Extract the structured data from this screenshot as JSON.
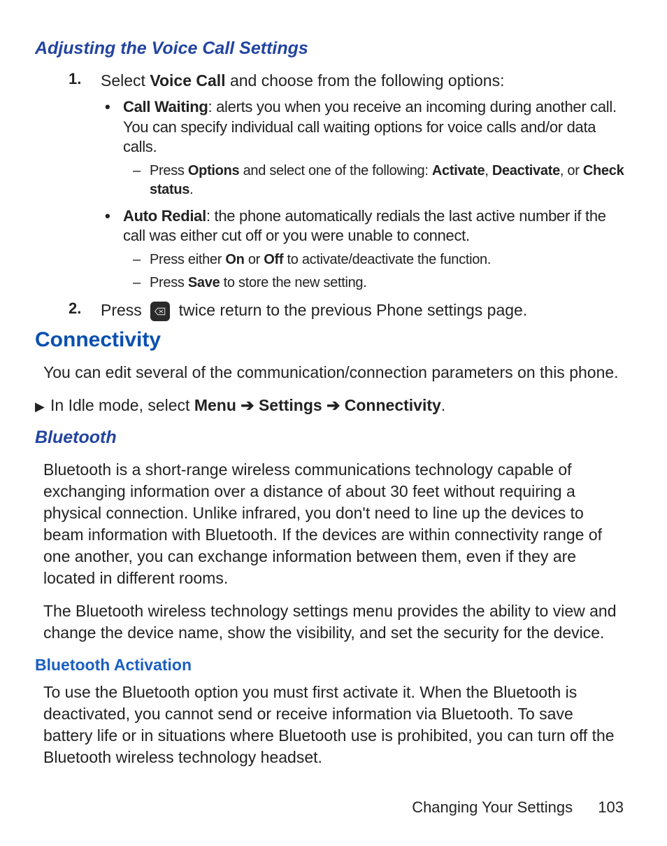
{
  "section1": {
    "heading": "Adjusting the Voice Call Settings",
    "step1_num": "1.",
    "step1_pre": "Select ",
    "step1_bold": "Voice Call",
    "step1_post": " and choose from the following options:",
    "bullet_cw_label": "Call Waiting",
    "bullet_cw_text": ": alerts you when you receive an incoming during another call. You can specify individual call waiting options for voice calls and/or data calls.",
    "dash_cw_pre": "Press ",
    "dash_cw_b1": "Options",
    "dash_cw_mid": " and select one of the following: ",
    "dash_cw_b2": "Activate",
    "dash_cw_sep1": ", ",
    "dash_cw_b3": "Deactivate",
    "dash_cw_sep2": ", or ",
    "dash_cw_b4": "Check status",
    "dash_cw_end": ".",
    "bullet_ar_label": "Auto Redial",
    "bullet_ar_text": ": the phone automatically redials the last active number if the call was either cut off or you were unable to connect.",
    "dash_ar1_pre": "Press either ",
    "dash_ar1_b1": "On",
    "dash_ar1_mid": " or ",
    "dash_ar1_b2": "Off",
    "dash_ar1_post": " to activate/deactivate the function.",
    "dash_ar2_pre": "Press ",
    "dash_ar2_b1": "Save",
    "dash_ar2_post": " to store the new setting.",
    "step2_num": "2.",
    "step2_pre": "Press ",
    "step2_post": " twice return to the previous Phone settings page."
  },
  "section2": {
    "heading": "Connectivity",
    "intro": "You can edit several of the communication/connection parameters on this phone.",
    "nav_pre": "In Idle mode, select ",
    "nav_b1": "Menu",
    "nav_arrow": " ➔ ",
    "nav_b2": "Settings",
    "nav_b3": "Connectivity",
    "nav_end": "."
  },
  "section3": {
    "heading": "Bluetooth",
    "para1": "Bluetooth is a short-range wireless communications technology capable of exchanging information over a distance of about 30 feet without requiring a physical connection. Unlike infrared, you don't need to line up the devices to beam information with Bluetooth. If the devices are within connectivity range of one another, you can exchange information between them, even if they are located in different rooms.",
    "para2": "The Bluetooth wireless technology settings menu provides the ability to view and change the device name, show the visibility, and set the security for the device."
  },
  "section4": {
    "heading": "Bluetooth Activation",
    "para": "To use the Bluetooth option you must first activate it. When the Bluetooth is deactivated, you cannot send or receive information via Bluetooth. To save battery life or in situations where Bluetooth use is prohibited, you can turn off the Bluetooth wireless technology headset."
  },
  "footer": {
    "chapter": "Changing Your Settings",
    "page": "103"
  }
}
